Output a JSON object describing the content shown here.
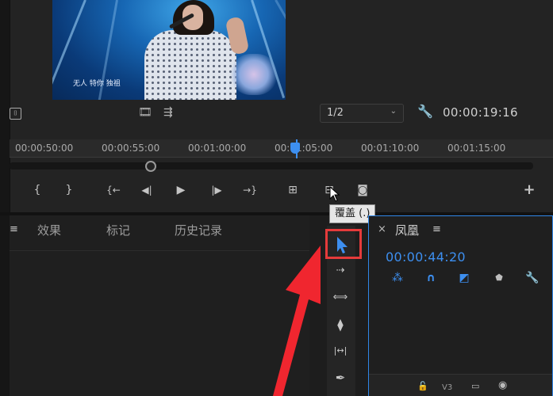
{
  "monitor": {
    "video_subtitle": "无人  特你  独祖",
    "resolution": {
      "value": "1/2"
    },
    "timecode": "00:00:19:16"
  },
  "ruler": {
    "ticks": [
      "00:00:50:00",
      "00:00:55:00",
      "00:01:00:00",
      "00:01:05:00",
      "00:01:10:00",
      "00:01:15:00"
    ],
    "playhead_position": "00:01:04:00"
  },
  "transport": {
    "buttons": [
      {
        "name": "mark-in-button",
        "glyph": "{"
      },
      {
        "name": "mark-out-button",
        "glyph": "}"
      },
      {
        "name": "go-to-in-button",
        "glyph": "{←"
      },
      {
        "name": "step-back-button",
        "glyph": "◀|"
      },
      {
        "name": "play-button",
        "glyph": "▶"
      },
      {
        "name": "step-forward-button",
        "glyph": "|▶"
      },
      {
        "name": "go-to-out-button",
        "glyph": "→}"
      },
      {
        "name": "insert-button",
        "glyph": "⊞"
      },
      {
        "name": "overwrite-button",
        "glyph": "⊟"
      },
      {
        "name": "export-frame-button",
        "glyph": "◙"
      },
      {
        "name": "add-button",
        "glyph": "+"
      }
    ]
  },
  "tooltip": {
    "text": "覆盖 (.)"
  },
  "panel": {
    "menu_glyph": "≡",
    "tabs": [
      "效果",
      "标记",
      "历史记录"
    ]
  },
  "tools": [
    {
      "name": "selection-tool",
      "glyph": "▲",
      "icon": "arrow-select-icon"
    },
    {
      "name": "track-select-tool",
      "glyph": "⇢",
      "icon": "track-select-icon"
    },
    {
      "name": "ripple-edit-tool",
      "glyph": "⟺",
      "icon": "ripple-edit-icon"
    },
    {
      "name": "razor-tool",
      "glyph": "⧫",
      "icon": "razor-icon"
    },
    {
      "name": "slip-tool",
      "glyph": "|↔|",
      "icon": "slip-icon"
    },
    {
      "name": "pen-tool",
      "glyph": "✒",
      "icon": "pen-icon"
    }
  ],
  "sequence": {
    "close_glyph": "×",
    "name": "凤凰",
    "menu_glyph": "≡",
    "timecode": "00:00:44:20",
    "track_label": "V3"
  },
  "colors": {
    "accent": "#3d8ff0",
    "highlight": "#e53b3b",
    "arrow": "#f0262f"
  }
}
